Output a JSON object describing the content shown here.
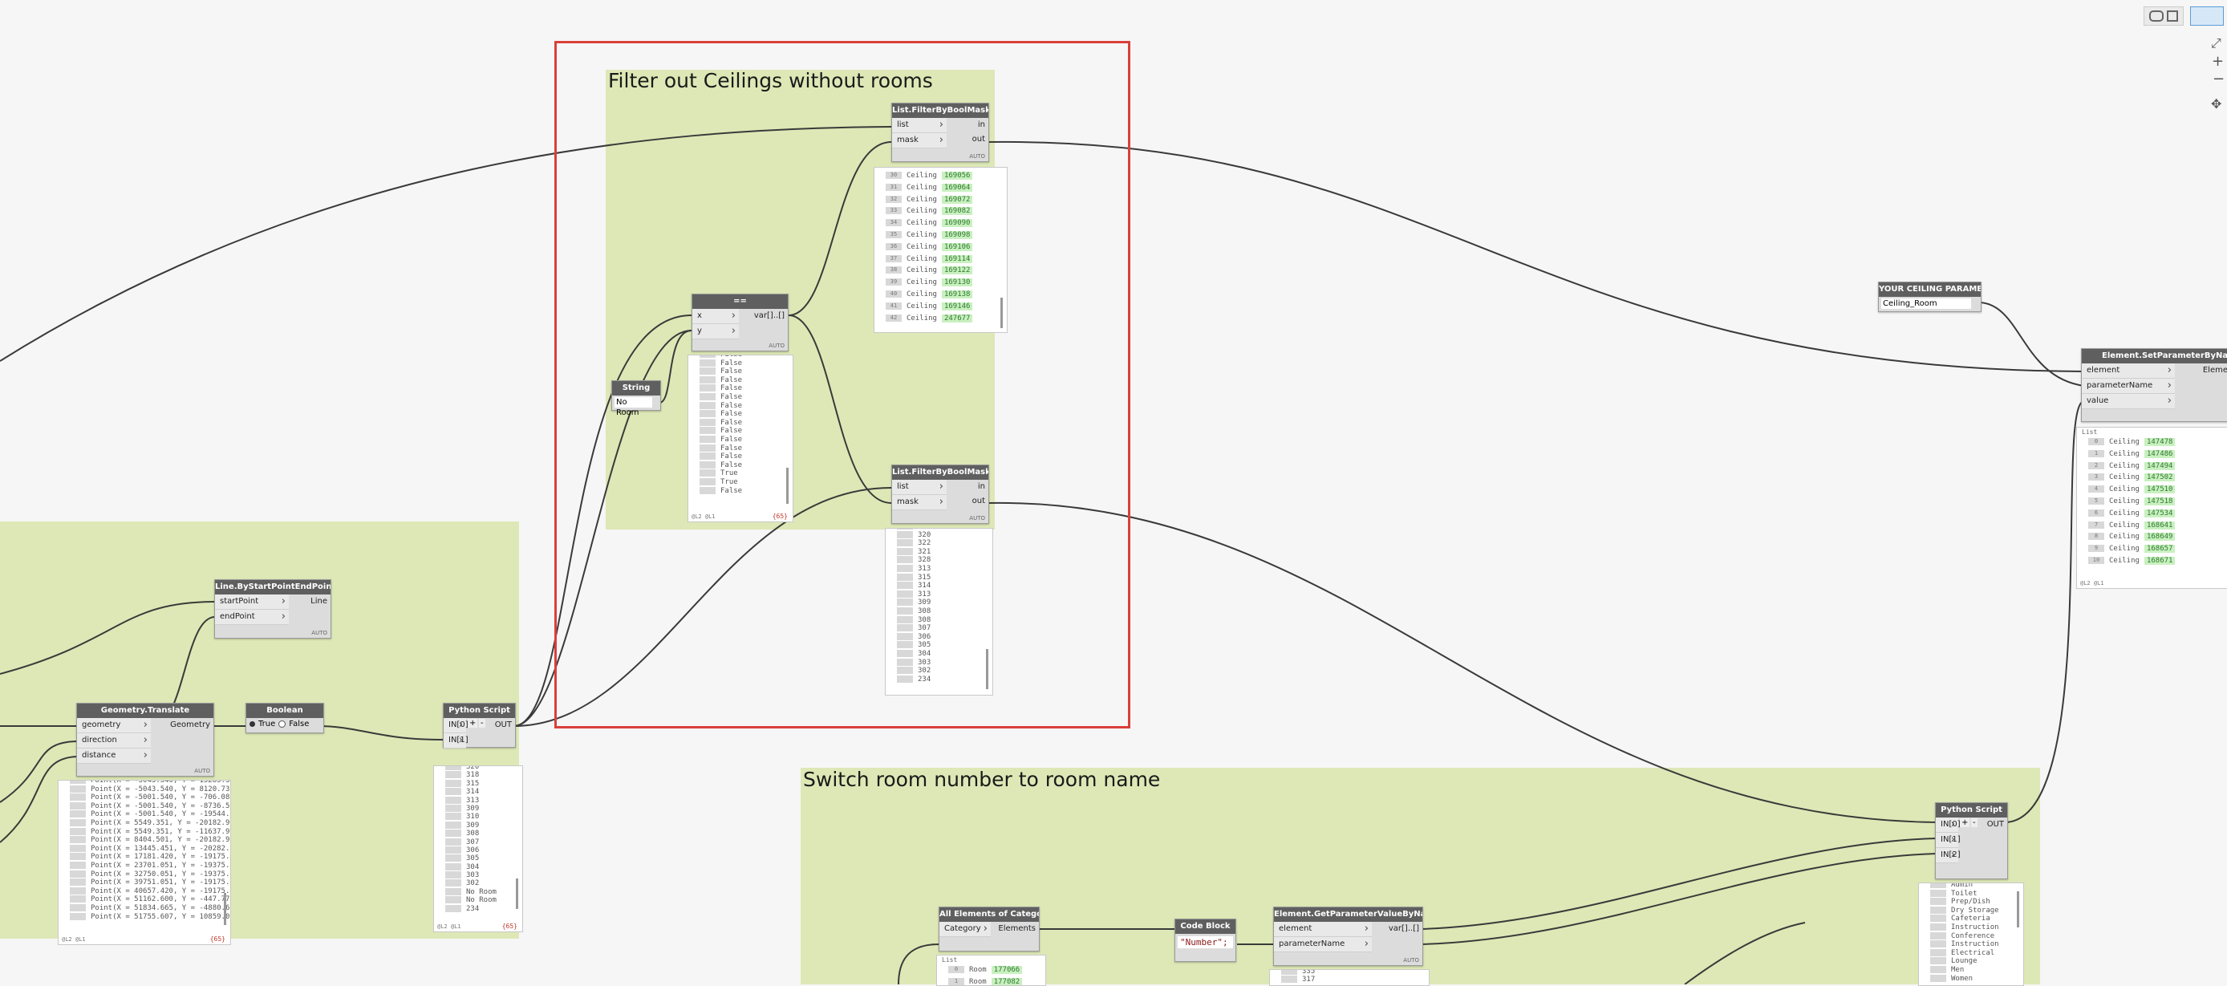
{
  "groups": {
    "filter_title": "Filter out Ceilings without rooms",
    "switch_title": "Switch room number to room name"
  },
  "nodes": {
    "filter_top": {
      "title": "List.FilterByBoolMask",
      "in": [
        "list",
        "mask"
      ],
      "out": [
        "in",
        "out"
      ],
      "lacing": "AUTO"
    },
    "filter_bottom": {
      "title": "List.FilterByBoolMask",
      "in": [
        "list",
        "mask"
      ],
      "out": [
        "in",
        "out"
      ],
      "lacing": "AUTO"
    },
    "equals": {
      "title": "==",
      "in": [
        "x",
        "y"
      ],
      "out": "var[]..[]",
      "lacing": "AUTO"
    },
    "string": {
      "title": "String",
      "value": "No Room"
    },
    "ceiling_param": {
      "title": "YOUR CEILING PARAMETER",
      "value": "Ceiling_Room"
    },
    "set_param": {
      "title": "Element.SetParameterByName",
      "in": [
        "element",
        "parameterName",
        "value"
      ],
      "out": "Eleme"
    },
    "line": {
      "title": "Line.ByStartPointEndPoint",
      "in": [
        "startPoint",
        "endPoint"
      ],
      "out": "Line",
      "lacing": "AUTO"
    },
    "translate": {
      "title": "Geometry.Translate",
      "in": [
        "geometry",
        "direction",
        "distance"
      ],
      "out": "Geometry",
      "lacing": "AUTO"
    },
    "boolean": {
      "title": "Boolean",
      "true_label": "True",
      "false_label": "False"
    },
    "python1": {
      "title": "Python Script",
      "in": [
        "IN[0]",
        "IN[1]"
      ],
      "out": "OUT",
      "plus": "+",
      "minus": "-"
    },
    "python2": {
      "title": "Python Script",
      "in": [
        "IN[0]",
        "IN[1]",
        "IN[2]"
      ],
      "out": "OUT",
      "plus": "+",
      "minus": "-"
    },
    "all_elements": {
      "title": "All Elements of Category",
      "in": [
        "Category"
      ],
      "out": "Elements"
    },
    "code_block": {
      "title": "Code Block",
      "code": "\"Number\";"
    },
    "get_param": {
      "title": "Element.GetParameterValueByName",
      "in": [
        "element",
        "parameterName"
      ],
      "out": "var[]..[]",
      "lacing": "AUTO"
    }
  },
  "previews": {
    "filter_top": {
      "rows": [
        {
          "idx": "30",
          "label": "Ceiling",
          "id": "169056"
        },
        {
          "idx": "31",
          "label": "Ceiling",
          "id": "169064"
        },
        {
          "idx": "32",
          "label": "Ceiling",
          "id": "169072"
        },
        {
          "idx": "33",
          "label": "Ceiling",
          "id": "169082"
        },
        {
          "idx": "34",
          "label": "Ceiling",
          "id": "169090"
        },
        {
          "idx": "35",
          "label": "Ceiling",
          "id": "169098"
        },
        {
          "idx": "36",
          "label": "Ceiling",
          "id": "169106"
        },
        {
          "idx": "37",
          "label": "Ceiling",
          "id": "169114"
        },
        {
          "idx": "38",
          "label": "Ceiling",
          "id": "169122"
        },
        {
          "idx": "39",
          "label": "Ceiling",
          "id": "169130"
        },
        {
          "idx": "40",
          "label": "Ceiling",
          "id": "169138"
        },
        {
          "idx": "41",
          "label": "Ceiling",
          "id": "169146"
        },
        {
          "idx": "42",
          "label": "Ceiling",
          "id": "247677"
        }
      ]
    },
    "equals": {
      "rows": [
        "False",
        "False",
        "False",
        "False",
        "False",
        "False",
        "False",
        "False",
        "False",
        "False",
        "False",
        "False",
        "False",
        "False",
        "True",
        "True",
        "False"
      ],
      "foot": "@L2 @L1",
      "count": "{65}"
    },
    "filter_bottom": {
      "rows": [
        "315",
        "320",
        "322",
        "321",
        "328",
        "313",
        "315",
        "314",
        "313",
        "309",
        "308",
        "308",
        "307",
        "306",
        "305",
        "304",
        "303",
        "302",
        "234"
      ]
    },
    "set_param": {
      "head": "List",
      "rows": [
        {
          "idx": "0",
          "label": "Ceiling",
          "id": "147478"
        },
        {
          "idx": "1",
          "label": "Ceiling",
          "id": "147486"
        },
        {
          "idx": "2",
          "label": "Ceiling",
          "id": "147494"
        },
        {
          "idx": "3",
          "label": "Ceiling",
          "id": "147502"
        },
        {
          "idx": "4",
          "label": "Ceiling",
          "id": "147510"
        },
        {
          "idx": "5",
          "label": "Ceiling",
          "id": "147518"
        },
        {
          "idx": "6",
          "label": "Ceiling",
          "id": "147534"
        },
        {
          "idx": "7",
          "label": "Ceiling",
          "id": "168641"
        },
        {
          "idx": "8",
          "label": "Ceiling",
          "id": "168649"
        },
        {
          "idx": "9",
          "label": "Ceiling",
          "id": "168657"
        },
        {
          "idx": "10",
          "label": "Ceiling",
          "id": "168671"
        }
      ],
      "foot": "@L2 @L1"
    },
    "translate": {
      "rows": [
        "Point(X = -5043.540, Y = 15285.30",
        "Point(X = -5043.540, Y = 8120.735",
        "Point(X = -5001.540, Y = -706.086",
        "Point(X = -5001.540, Y = -8736.52",
        "Point(X = -5001.540, Y = -19544.5",
        "Point(X = 5549.351, Y = -20182.91",
        "Point(X = 5549.351, Y = -11637.93",
        "Point(X = 8404.501, Y = -20182.91",
        "Point(X = 13445.451, Y = -20282.5",
        "Point(X = 17181.420, Y = -19175.4",
        "Point(X = 23701.051, Y = -19375.4",
        "Point(X = 32750.051, Y = -19375.4",
        "Point(X = 39751.051, Y = -19175.4",
        "Point(X = 40657.420, Y = -19175.4",
        "Point(X = 51162.600, Y = -447.775,",
        "Point(X = 51834.665, Y = -4880.66",
        "Point(X = 51755.607, Y = 10859.02"
      ],
      "foot": "@L2 @L1",
      "count": "{65}"
    },
    "python1": {
      "rows": [
        "320",
        "318",
        "315",
        "314",
        "313",
        "309",
        "310",
        "309",
        "308",
        "307",
        "306",
        "305",
        "304",
        "303",
        "302",
        "No Room",
        "No Room",
        "234"
      ],
      "foot": "@L2 @L1",
      "count": "{65}"
    },
    "python2": {
      "rows": [
        "Admin",
        "Toilet",
        "Prep/Dish",
        "Dry Storage",
        "Cafeteria",
        "Instruction",
        "Conference",
        "Instruction",
        "Electrical",
        "Lounge",
        "Men",
        "Women"
      ]
    },
    "all_elements": {
      "head": "List",
      "rows": [
        {
          "idx": "0",
          "label": "Room",
          "id": "177066"
        },
        {
          "idx": "1",
          "label": "Room",
          "id": "177082"
        }
      ]
    },
    "get_param": {
      "rows": [
        "335",
        "317"
      ]
    }
  },
  "colors": {
    "group_fill": "#dde8b6",
    "selection": "#d9403a",
    "wire": "#3a3a3a",
    "node_header": "#5f5f5f",
    "element_id_bg": "#c9f0c0"
  }
}
